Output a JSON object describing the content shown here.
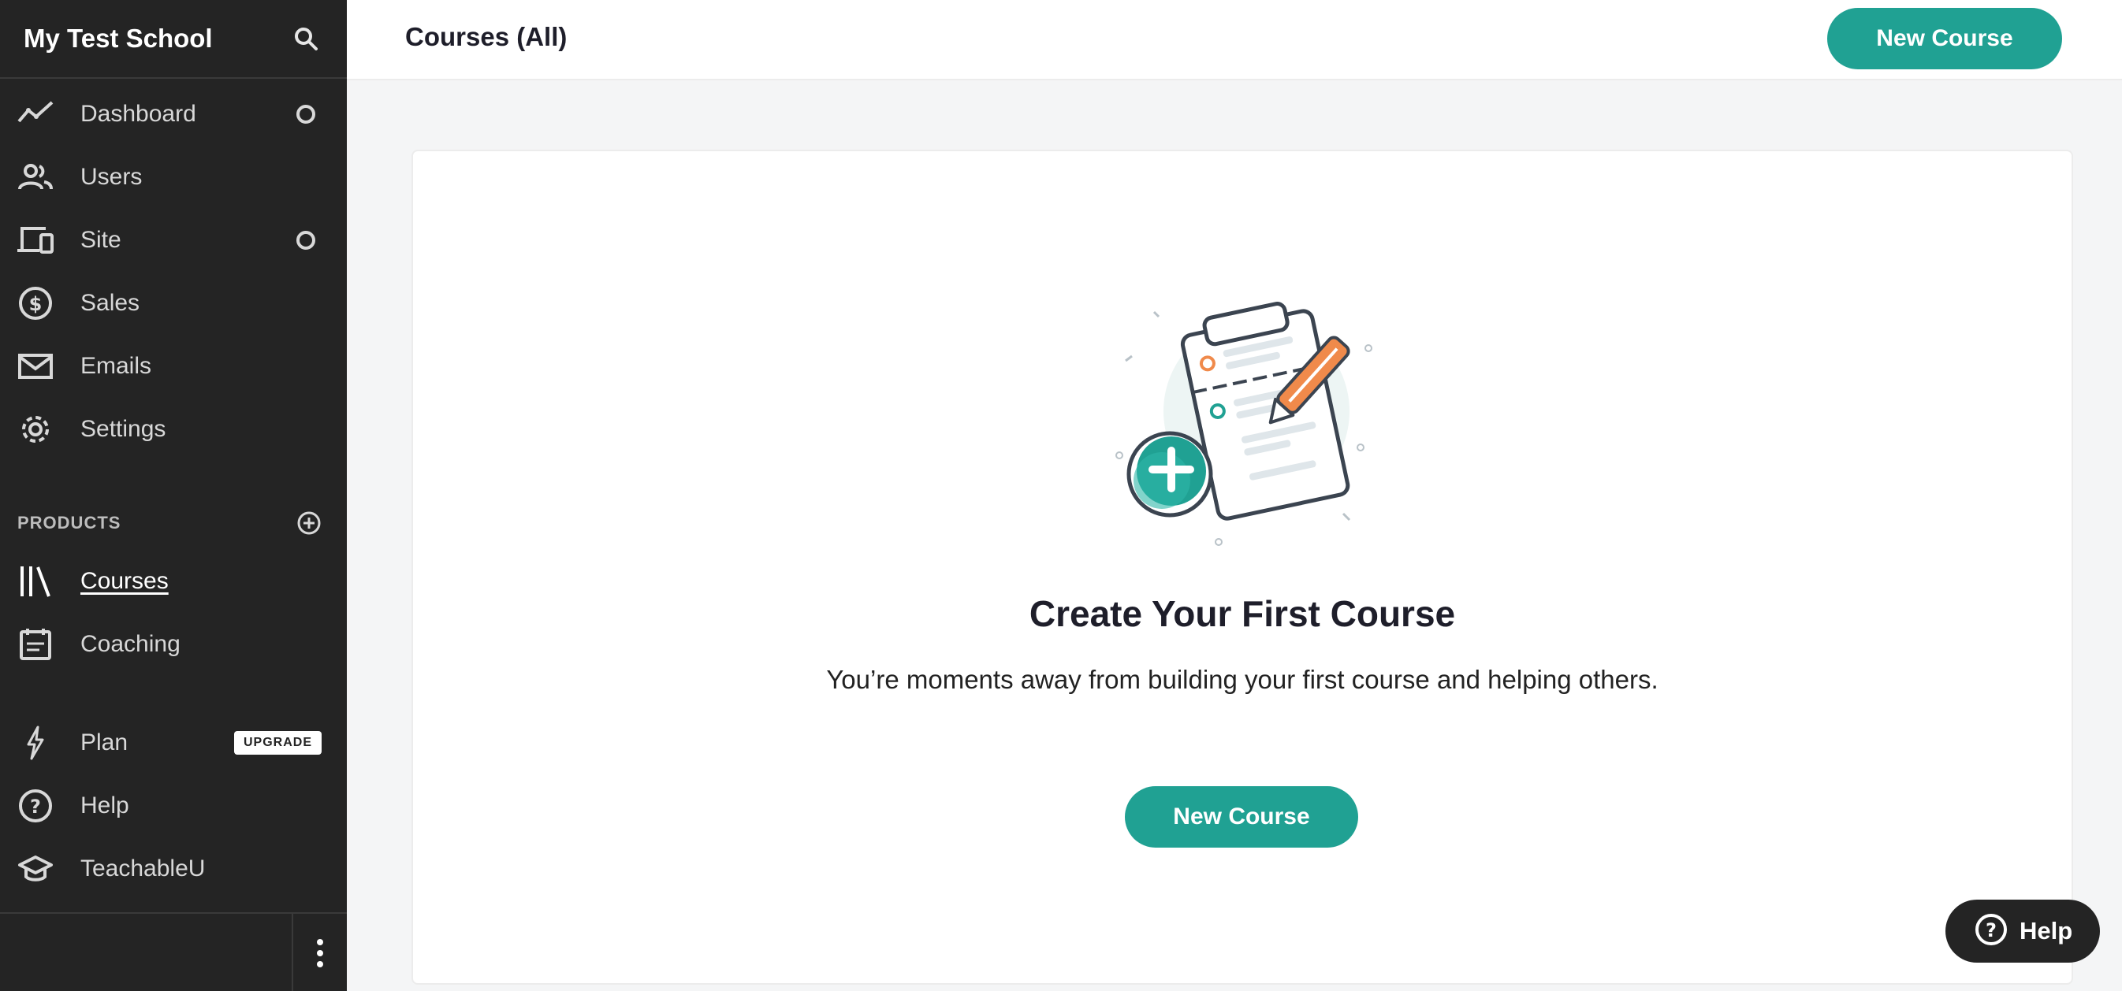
{
  "sidebar": {
    "school_name": "My Test School",
    "nav": [
      {
        "label": "Dashboard",
        "icon": "trend-line-icon"
      },
      {
        "label": "Users",
        "icon": "users-icon"
      },
      {
        "label": "Site",
        "icon": "devices-icon"
      },
      {
        "label": "Sales",
        "icon": "dollar-circle-icon"
      },
      {
        "label": "Emails",
        "icon": "envelope-icon"
      },
      {
        "label": "Settings",
        "icon": "gear-icon"
      }
    ],
    "products_section_label": "PRODUCTS",
    "products": [
      {
        "label": "Courses",
        "icon": "library-icon",
        "active": true
      },
      {
        "label": "Coaching",
        "icon": "calendar-icon"
      }
    ],
    "bottom_nav": [
      {
        "label": "Plan",
        "icon": "lightning-icon",
        "badge": "UPGRADE"
      },
      {
        "label": "Help",
        "icon": "question-circle-icon"
      },
      {
        "label": "TeachableU",
        "icon": "graduation-cap-icon"
      }
    ]
  },
  "header": {
    "title": "Courses (All)",
    "new_course_label": "New Course"
  },
  "empty_state": {
    "title": "Create Your First Course",
    "description": "You’re moments away from building your first course and helping others.",
    "button_label": "New Course"
  },
  "help_widget": {
    "label": "Help"
  },
  "colors": {
    "accent": "#20a193",
    "sidebar_bg": "#242424",
    "illustration_orange": "#f08a4b"
  }
}
